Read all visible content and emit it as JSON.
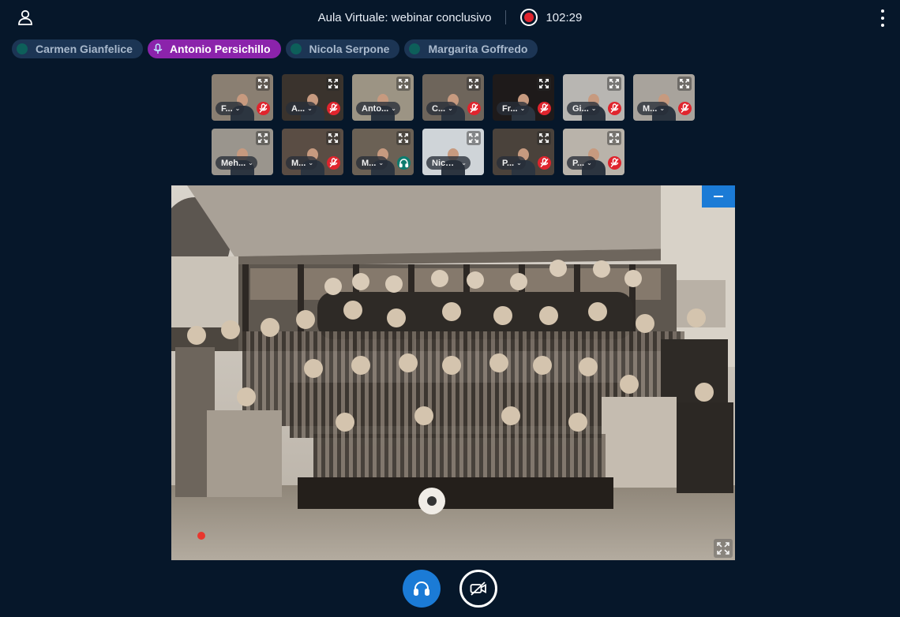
{
  "header": {
    "title": "Aula Virtuale: webinar conclusivo",
    "timer": "102:29",
    "user_icon": "user-icon",
    "record_icon": "record-icon",
    "more_icon": "more-vertical-icon"
  },
  "talkers": [
    {
      "name": "Carmen Gianfelice",
      "active": false
    },
    {
      "name": "Antonio Persichillo",
      "active": true
    },
    {
      "name": "Nicola Serpone",
      "active": false
    },
    {
      "name": "Margarita Goffredo",
      "active": false
    }
  ],
  "tiles": [
    {
      "name": "F...",
      "status": "muted"
    },
    {
      "name": "A...",
      "status": "muted"
    },
    {
      "name": "Anto...",
      "status": "none"
    },
    {
      "name": "C...",
      "status": "muted"
    },
    {
      "name": "Fr...",
      "status": "muted"
    },
    {
      "name": "Gi...",
      "status": "muted"
    },
    {
      "name": "M...",
      "status": "muted"
    },
    {
      "name": "Meh...",
      "status": "none"
    },
    {
      "name": "M...",
      "status": "muted"
    },
    {
      "name": "M...",
      "status": "listen"
    },
    {
      "name": "Nicol...",
      "status": "none"
    },
    {
      "name": "P...",
      "status": "muted"
    },
    {
      "name": "P...",
      "status": "muted"
    }
  ],
  "presentation": {
    "minimize_icon": "minimize-icon",
    "fullscreen_icon": "fullscreen-icon"
  },
  "controls": {
    "audio_icon": "headphones-icon",
    "video_icon": "video-off-icon"
  },
  "colors": {
    "background": "#06172a",
    "accent_blue": "#1b7bd6",
    "active_talker": "#8b23ab",
    "muted_red": "#e0242d",
    "listen_teal": "#0d7c6f"
  }
}
